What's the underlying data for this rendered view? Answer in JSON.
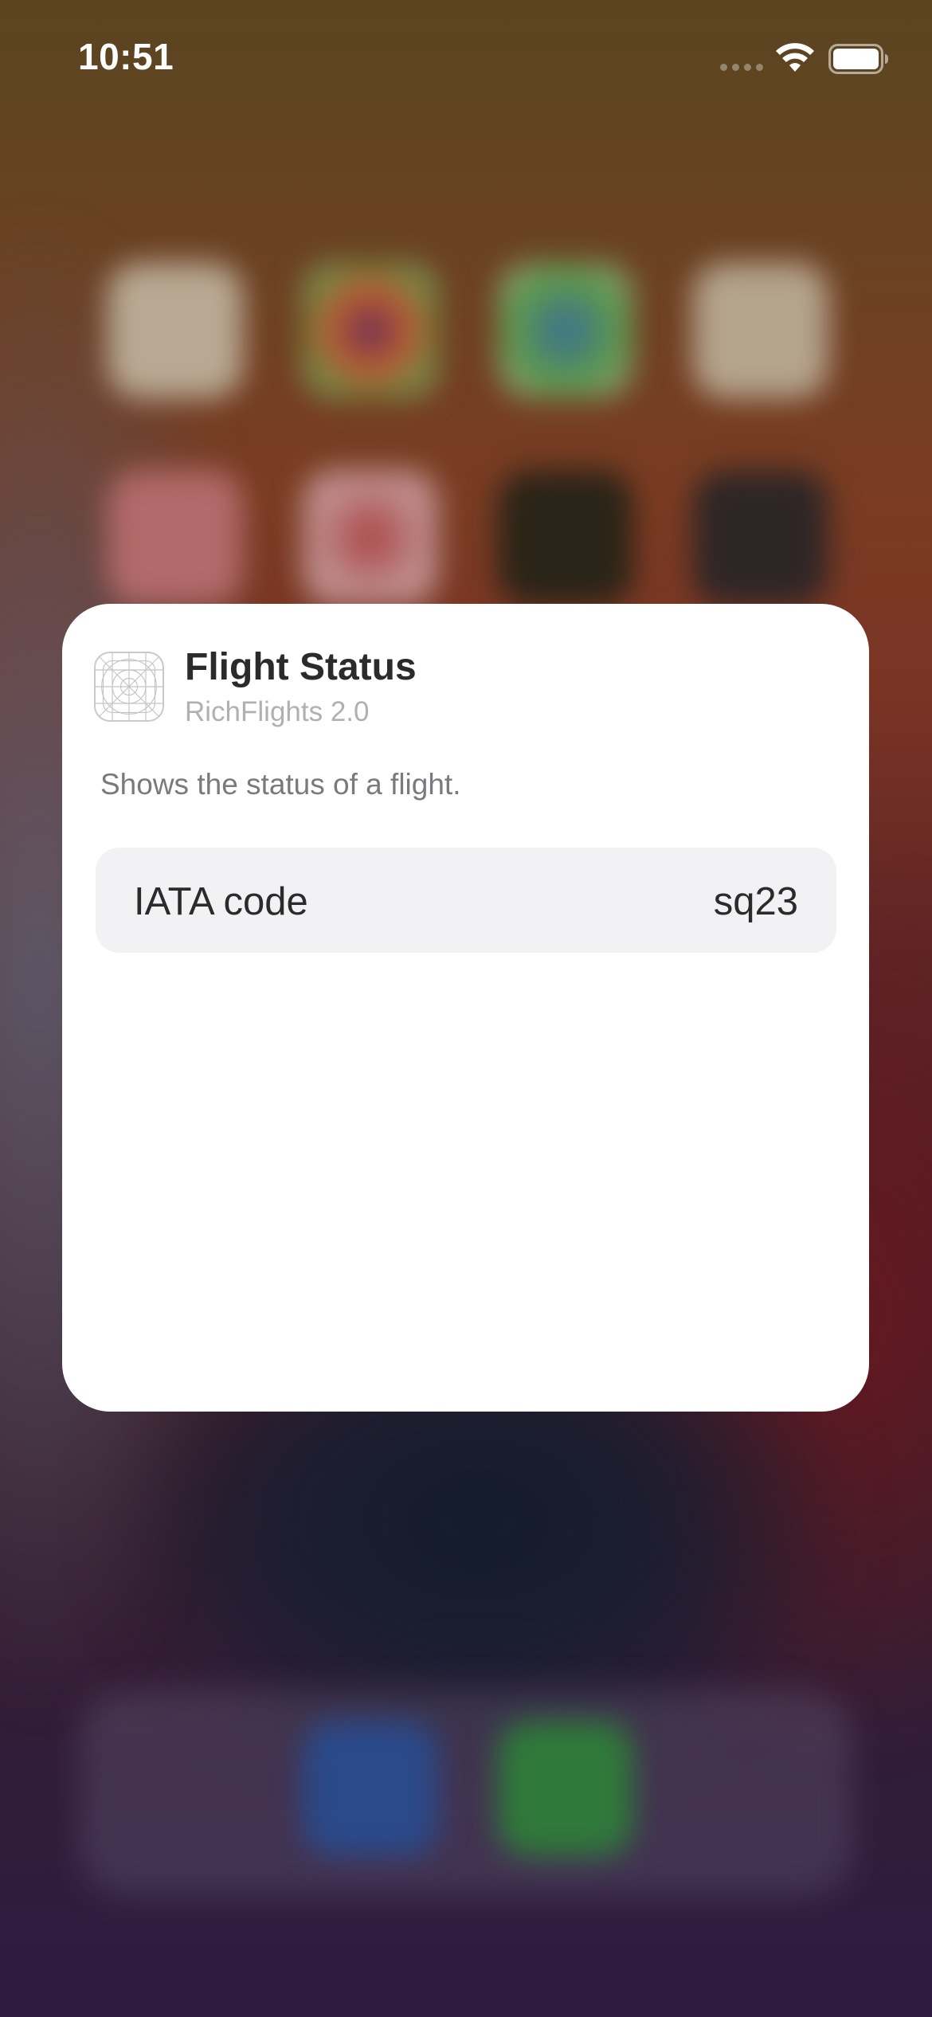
{
  "status_bar": {
    "time": "10:51"
  },
  "shortcut_card": {
    "title": "Flight Status",
    "subtitle": "RichFlights 2.0",
    "description": "Shows the status of a flight.",
    "parameter": {
      "label": "IATA code",
      "value": "sq23"
    }
  },
  "icons": {
    "wifi": "wifi-icon",
    "battery": "battery-icon",
    "signal": "cellular-signal-icon",
    "app": "app-placeholder-icon"
  },
  "colors": {
    "card_background": "#ffffff",
    "parameter_row_background": "#f2f2f5",
    "primary_text": "#2b2b2b",
    "secondary_text": "#7a7a7e",
    "subtitle_text": "#b0b0b4"
  }
}
